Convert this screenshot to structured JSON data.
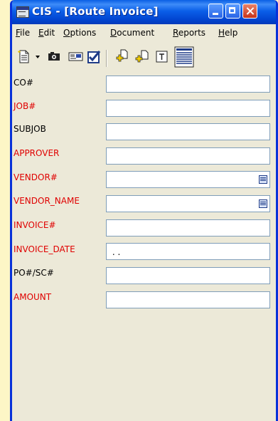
{
  "window": {
    "title": "CIS - [Route Invoice]"
  },
  "menu": [
    {
      "label": "File",
      "accel": "F",
      "rest": "ile"
    },
    {
      "label": "Edit",
      "accel": "E",
      "rest": "dit"
    },
    {
      "label": "Options",
      "accel": "O",
      "rest": "ptions"
    },
    {
      "label": "Document",
      "accel": "D",
      "rest": "ocument"
    },
    {
      "label": "Reports",
      "accel": "R",
      "rest": "eports"
    },
    {
      "label": "Help",
      "accel": "H",
      "rest": "elp"
    }
  ],
  "toolbar": {
    "icons": [
      "new-document-icon",
      "dropdown-arrow-icon",
      "camera-icon",
      "card-icon",
      "checkbox-icon",
      "add-document-icon",
      "add-page-icon",
      "text-icon",
      "list-view-icon"
    ]
  },
  "form": {
    "fields": [
      {
        "label": "CO#",
        "value": "",
        "color": "#000000",
        "lookup": false
      },
      {
        "label": "JOB#",
        "value": "",
        "color": "#e00000",
        "lookup": false
      },
      {
        "label": "SUBJOB",
        "value": "",
        "color": "#000000",
        "lookup": false
      },
      {
        "label": "APPROVER",
        "value": "",
        "color": "#e00000",
        "lookup": false
      },
      {
        "label": "VENDOR#",
        "value": "",
        "color": "#e00000",
        "lookup": true
      },
      {
        "label": "VENDOR_NAME",
        "value": "",
        "color": "#e00000",
        "lookup": true
      },
      {
        "label": "INVOICE#",
        "value": "",
        "color": "#e00000",
        "lookup": false
      },
      {
        "label": "INVOICE_DATE",
        "value": " . .",
        "color": "#e00000",
        "lookup": false
      },
      {
        "label": "PO#/SC#",
        "value": "",
        "color": "#000000",
        "lookup": false
      },
      {
        "label": "AMOUNT",
        "value": "",
        "color": "#e00000",
        "lookup": false
      }
    ]
  }
}
